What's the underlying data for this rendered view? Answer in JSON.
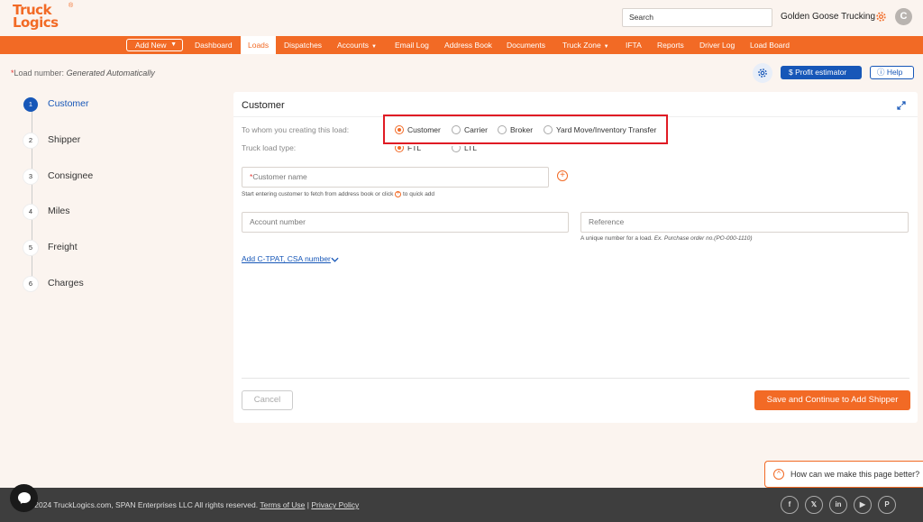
{
  "brand": {
    "line1": "Truck",
    "line2": "Logics",
    "reg": "®",
    "accent": "#f26a25",
    "blue": "#1757b8"
  },
  "header": {
    "search_value": "Search",
    "company": "Golden Goose Trucking",
    "avatar_initial": "C"
  },
  "nav": {
    "add_new": "Add New",
    "items": [
      "Dashboard",
      "Loads",
      "Dispatches",
      "Accounts",
      "Email Log",
      "Address Book",
      "Documents",
      "Truck Zone",
      "IFTA",
      "Reports",
      "Driver Log",
      "Load Board"
    ],
    "active": "Loads"
  },
  "subheader": {
    "load_number_star": "*",
    "load_number_label": "Load number: ",
    "load_number_value": "Generated Automatically",
    "profit_label": "Profit estimator",
    "help_label": "Help"
  },
  "steps": [
    {
      "num": "1",
      "label": "Customer"
    },
    {
      "num": "2",
      "label": "Shipper"
    },
    {
      "num": "3",
      "label": "Consignee"
    },
    {
      "num": "4",
      "label": "Miles"
    },
    {
      "num": "5",
      "label": "Freight"
    },
    {
      "num": "6",
      "label": "Charges"
    }
  ],
  "card": {
    "title": "Customer",
    "whom_label": "To whom you creating this load:",
    "whom_options": [
      "Customer",
      "Carrier",
      "Broker",
      "Yard Move/Inventory Transfer"
    ],
    "whom_selected": "Customer",
    "type_label": "Truck load type:",
    "type_options": [
      "FTL",
      "LTL"
    ],
    "type_selected": "FTL",
    "customer_star": "*",
    "customer_placeholder": "Customer name",
    "customer_hint_pre": "Start entering customer to fetch from address book or click",
    "customer_hint_post": "to quick add",
    "account_placeholder": "Account number",
    "reference_placeholder": "Reference",
    "reference_hint_pre": "A unique number for a load.",
    "reference_hint_italic": "Ex. Purchase order no.(PO-000-1110)",
    "add_link": "Add C-TPAT, CSA number",
    "cancel_label": "Cancel",
    "save_label": "Save and Continue to Add Shipper"
  },
  "feedback": {
    "text": "How can we make this page better?"
  },
  "footer": {
    "copyright": "©2024 TruckLogics.com, SPAN Enterprises LLC All rights reserved. ",
    "terms": "Terms of Use",
    "sep": " | ",
    "privacy": "Privacy Policy",
    "social": [
      "f",
      "𝕏",
      "in",
      "▶",
      "P"
    ]
  }
}
